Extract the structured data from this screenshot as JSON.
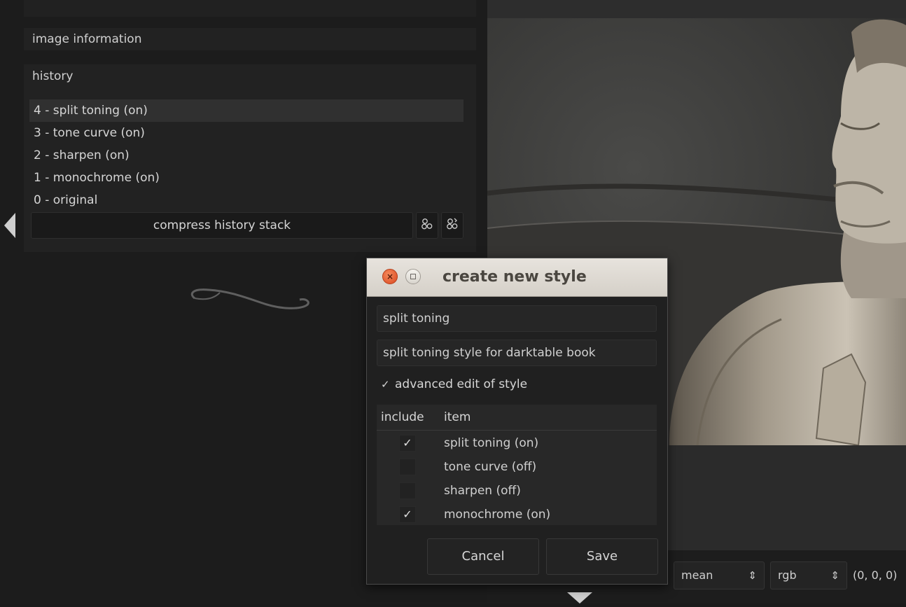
{
  "left_panel": {
    "image_info_title": "image information",
    "history": {
      "title": "history",
      "items": [
        {
          "label": "4 - split toning (on)",
          "selected": true
        },
        {
          "label": "3 - tone curve (on)",
          "selected": false
        },
        {
          "label": "2 - sharpen (on)",
          "selected": false
        },
        {
          "label": "1 - monochrome (on)",
          "selected": false
        },
        {
          "label": "0 - original",
          "selected": false
        }
      ],
      "compress_label": "compress history stack",
      "buttons": [
        "create-style-icon",
        "create-style-edit-icon"
      ]
    }
  },
  "dialog": {
    "title": "create new style",
    "name_value": "split toning",
    "description_value": "split toning style for darktable book",
    "advanced_edit": {
      "label": "advanced edit of style",
      "checked": true
    },
    "table": {
      "col_include": "include",
      "col_item": "item",
      "rows": [
        {
          "label": "split toning (on)",
          "included": true
        },
        {
          "label": "tone curve (off)",
          "included": false
        },
        {
          "label": "sharpen (off)",
          "included": false
        },
        {
          "label": "monochrome (on)",
          "included": true
        }
      ]
    },
    "cancel_label": "Cancel",
    "save_label": "Save"
  },
  "bottom_bar": {
    "mode_value": "mean",
    "colorspace_value": "rgb",
    "readout": "(0, 0, 0)"
  }
}
